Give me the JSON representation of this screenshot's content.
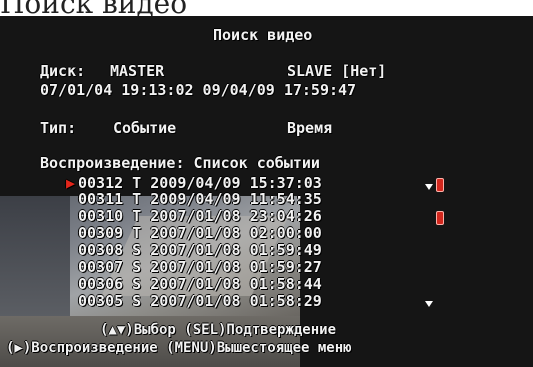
{
  "header_strip_text": "Поиск видео",
  "screen": {
    "title": "Поиск видео",
    "disk": {
      "label": "Диск:",
      "master": "MASTER",
      "slave": "SLAVE [Нет]",
      "range_text": "07/01/04 19:13:02 09/04/09 17:59:47"
    },
    "type": {
      "label": "Тип:",
      "value": "Событие",
      "sort": "Время"
    },
    "list_heading": "Воспроизведение: Список событии",
    "events": [
      {
        "text": "00312 T 2009/04/09 15:37:03",
        "selected": true,
        "locked": true,
        "scroll_up": true
      },
      {
        "text": "00311 T 2009/04/09 11:54:35"
      },
      {
        "text": "00310 T 2007/01/08 23:04:26",
        "locked": true
      },
      {
        "text": "00309 T 2007/01/08 02:00:00"
      },
      {
        "text": "00308 S 2007/01/08 01:59:49"
      },
      {
        "text": "00307 S 2007/01/08 01:59:27"
      },
      {
        "text": "00306 S 2007/01/08 01:58:44"
      },
      {
        "text": "00305 S 2007/01/08 01:58:29",
        "scroll_down": true
      }
    ],
    "help_line_1": "(▲▼)Выбор (SEL)Подтверждение",
    "help_line_2": "(▶)Воспроизведение (MENU)Вышестоящее меню"
  },
  "colors": {
    "background": "#151515",
    "text": "#f2f2f2",
    "cursor": "#e2261b",
    "lock": "#d3271d"
  },
  "icons": {
    "cursor": "play-cursor-icon",
    "lock": "lock-icon",
    "scroll": "triangle-down-icon"
  }
}
